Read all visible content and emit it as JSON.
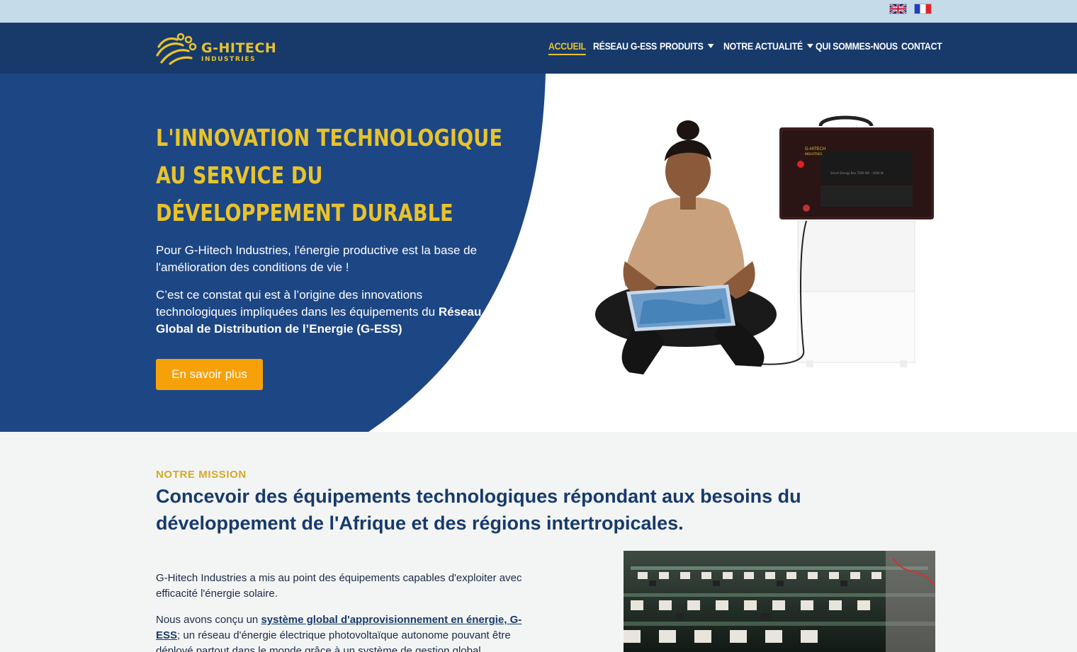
{
  "lang_bar": {
    "languages": [
      {
        "code": "en",
        "icon": "uk-flag-icon"
      },
      {
        "code": "fr",
        "icon": "france-flag-icon"
      }
    ]
  },
  "brand": {
    "name": "G-HITECH",
    "tagline": "INDUSTRIES",
    "color": "#e8c32c"
  },
  "nav": {
    "items": [
      {
        "label": "ACCUEIL",
        "active": true
      },
      {
        "label": "RÉSEAU G-ESS"
      },
      {
        "label": "PRODUITS",
        "dropdown": true
      },
      {
        "label": "NOTRE ACTUALITÉ",
        "dropdown": true
      },
      {
        "label": "QUI SOMMES-NOUS"
      },
      {
        "label": "CONTACT"
      }
    ],
    "background": "#173a6b"
  },
  "hero": {
    "title_lines": [
      "L'INNOVATION TECHNOLOGIQUE",
      "AU SERVICE DU",
      "DÉVELOPPEMENT DURABLE"
    ],
    "paragraph1": "Pour G-Hitech Industries, l'énergie productive est la base de l'amélioration des conditions de vie !",
    "paragraph2": "C’est ce constat qui est à l’origine des innovations technologiques impliquées dans les équipements du",
    "paragraph2_bold": "Réseau Global de Distribution de l’Energie (G-ESS)",
    "cta_label": "En savoir plus",
    "device_label": "G-HITECH",
    "device_sublabel": "INDUSTRIES",
    "device_model": "Smart Energy Box 7200 Wh - 2000 W",
    "accent": "#f7a10a",
    "panel_color": "#1d4684"
  },
  "mission": {
    "eyebrow": "NOTRE MISSION",
    "title": "Concevoir des équipements technologiques répondant aux besoins du développement de l'Afrique et des régions intertropicales.",
    "paragraph1": "G-Hitech Industries a mis au point des équipements capables d'exploiter avec efficacité l'énergie solaire.",
    "paragraph2_start": "Nous avons conçu un ",
    "paragraph2_link": "système global d'approvisionnement en énergie, G-ESS",
    "paragraph2_rest": "; un réseau d'énergie électrique photovoltaïque autonome pouvant être déployé partout dans le monde grâce à un système de gestion global"
  }
}
